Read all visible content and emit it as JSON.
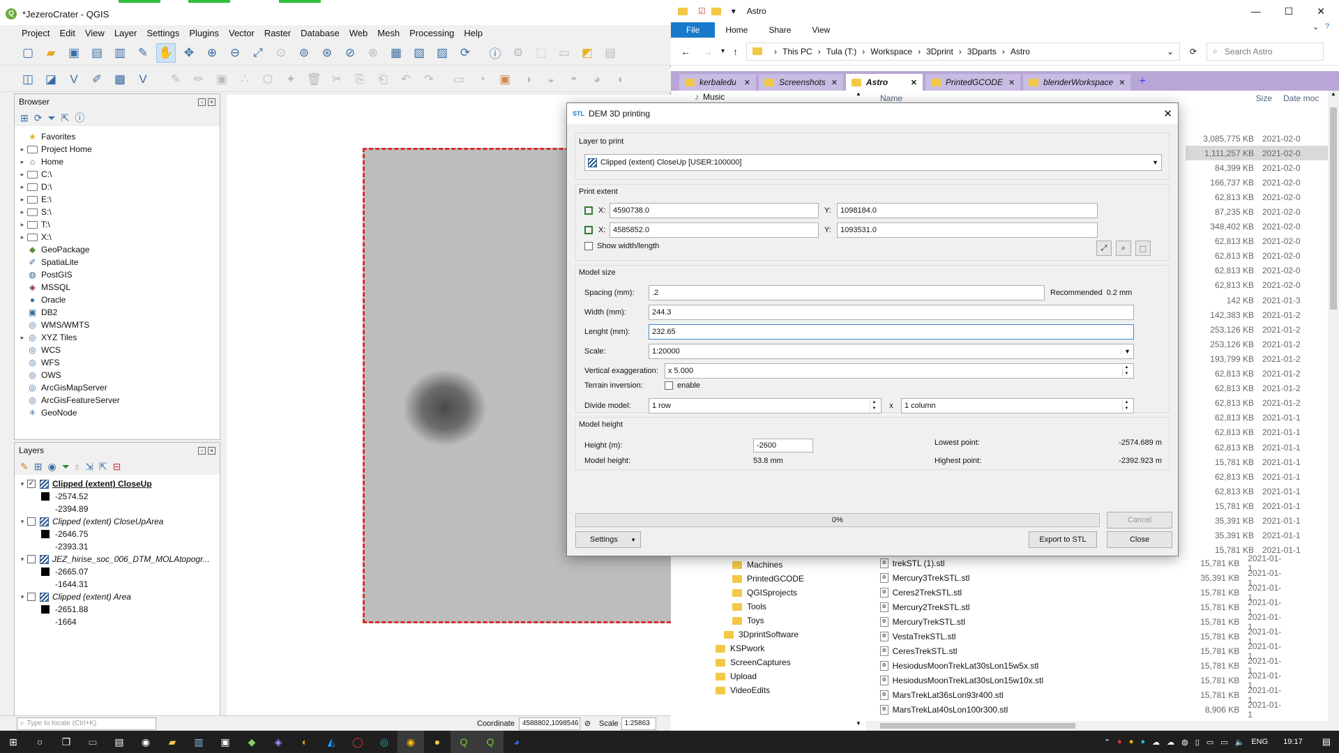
{
  "qgis": {
    "title": "*JezeroCrater - QGIS",
    "menus": [
      "Project",
      "Edit",
      "View",
      "Layer",
      "Settings",
      "Plugins",
      "Vector",
      "Raster",
      "Database",
      "Web",
      "Mesh",
      "Processing",
      "Help"
    ],
    "browser": {
      "title": "Browser",
      "items": [
        {
          "label": "Favorites",
          "icon": "star-icon",
          "arrow": ""
        },
        {
          "label": "Project Home",
          "icon": "folder-icon",
          "arrow": "▸"
        },
        {
          "label": "Home",
          "icon": "home-icon",
          "arrow": "▸"
        },
        {
          "label": "C:\\",
          "icon": "folder-icon",
          "arrow": "▸"
        },
        {
          "label": "D:\\",
          "icon": "folder-icon",
          "arrow": "▸"
        },
        {
          "label": "E:\\",
          "icon": "folder-icon",
          "arrow": "▸"
        },
        {
          "label": "S:\\",
          "icon": "folder-icon",
          "arrow": "▸"
        },
        {
          "label": "T:\\",
          "icon": "folder-icon",
          "arrow": "▸"
        },
        {
          "label": "X:\\",
          "icon": "folder-icon",
          "arrow": "▸"
        },
        {
          "label": "GeoPackage",
          "icon": "geopackage-icon",
          "arrow": ""
        },
        {
          "label": "SpatiaLite",
          "icon": "spatialite-icon",
          "arrow": ""
        },
        {
          "label": "PostGIS",
          "icon": "postgis-icon",
          "arrow": ""
        },
        {
          "label": "MSSQL",
          "icon": "mssql-icon",
          "arrow": ""
        },
        {
          "label": "Oracle",
          "icon": "oracle-icon",
          "arrow": ""
        },
        {
          "label": "DB2",
          "icon": "db2-icon",
          "arrow": ""
        },
        {
          "label": "WMS/WMTS",
          "icon": "globe-icon",
          "arrow": ""
        },
        {
          "label": "XYZ Tiles",
          "icon": "globe-icon",
          "arrow": "▸"
        },
        {
          "label": "WCS",
          "icon": "globe-icon",
          "arrow": ""
        },
        {
          "label": "WFS",
          "icon": "globe-icon",
          "arrow": ""
        },
        {
          "label": "OWS",
          "icon": "globe-icon",
          "arrow": ""
        },
        {
          "label": "ArcGisMapServer",
          "icon": "globe-icon",
          "arrow": ""
        },
        {
          "label": "ArcGisFeatureServer",
          "icon": "globe-icon",
          "arrow": ""
        },
        {
          "label": "GeoNode",
          "icon": "geonode-icon",
          "arrow": ""
        }
      ]
    },
    "layers": {
      "title": "Layers",
      "items": [
        {
          "name": "Clipped (extent) CloseUp",
          "checked": true,
          "active": true,
          "min": "-2574.52",
          "max": "-2394.89"
        },
        {
          "name": "Clipped (extent) CloseUpArea",
          "checked": false,
          "active": false,
          "min": "-2646.75",
          "max": "-2393.31"
        },
        {
          "name": "JEZ_hirise_soc_006_DTM_MOLAtopogr...",
          "checked": false,
          "active": false,
          "min": "-2665.07",
          "max": "-1644.31"
        },
        {
          "name": "Clipped (extent) Area",
          "checked": false,
          "active": false,
          "min": "-2651.88",
          "max": "-1664"
        }
      ]
    },
    "status": {
      "locate_placeholder": "Type to locate (Ctrl+K)",
      "coord_label": "Coordinate",
      "coord_value": "4588802,1098546",
      "scale_label": "Scale",
      "scale_value": "1:25863"
    }
  },
  "explorer": {
    "title": "Astro",
    "ribbon": [
      "File",
      "Home",
      "Share",
      "View"
    ],
    "breadcrumb": [
      "This PC",
      "Tula (T:)",
      "Workspace",
      "3Dprint",
      "3Dparts",
      "Astro"
    ],
    "search_placeholder": "Search Astro",
    "tabs": [
      {
        "label": "kerbaledu",
        "active": false
      },
      {
        "label": "Screenshots",
        "active": false
      },
      {
        "label": "Astro",
        "active": true
      },
      {
        "label": "PrintedGCODE",
        "active": false
      },
      {
        "label": "blenderWorkspace",
        "active": false
      }
    ],
    "col_name": "Name",
    "col_size": "Size",
    "col_date": "Date moc",
    "nav_top": "Music",
    "nav_items": [
      {
        "label": "Machines",
        "indent": 1
      },
      {
        "label": "PrintedGCODE",
        "indent": 1
      },
      {
        "label": "QGISprojects",
        "indent": 1
      },
      {
        "label": "Tools",
        "indent": 1
      },
      {
        "label": "Toys",
        "indent": 1
      },
      {
        "label": "3DprintSoftware",
        "indent": 0.5
      },
      {
        "label": "KSPwork",
        "indent": 0
      },
      {
        "label": "ScreenCaptures",
        "indent": 0
      },
      {
        "label": "Upload",
        "indent": 0
      },
      {
        "label": "VideoEdits",
        "indent": 0
      }
    ],
    "sizes_top": [
      {
        "size": "3,085,775 KB",
        "date": "2021-02-0"
      },
      {
        "size": "1,111,257 KB",
        "date": "2021-02-0"
      },
      {
        "size": "84,399 KB",
        "date": "2021-02-0"
      },
      {
        "size": "166,737 KB",
        "date": "2021-02-0"
      },
      {
        "size": "62,813 KB",
        "date": "2021-02-0"
      },
      {
        "size": "87,235 KB",
        "date": "2021-02-0"
      },
      {
        "size": "348,402 KB",
        "date": "2021-02-0"
      },
      {
        "size": "62,813 KB",
        "date": "2021-02-0"
      },
      {
        "size": "62,813 KB",
        "date": "2021-02-0"
      },
      {
        "size": "62,813 KB",
        "date": "2021-02-0"
      },
      {
        "size": "62,813 KB",
        "date": "2021-02-0"
      },
      {
        "size": "142 KB",
        "date": "2021-01-3"
      },
      {
        "size": "142,383 KB",
        "date": "2021-01-2"
      },
      {
        "size": "253,126 KB",
        "date": "2021-01-2"
      },
      {
        "size": "253,126 KB",
        "date": "2021-01-2"
      },
      {
        "size": "193,799 KB",
        "date": "2021-01-2"
      },
      {
        "size": "62,813 KB",
        "date": "2021-01-2"
      },
      {
        "size": "62,813 KB",
        "date": "2021-01-2"
      },
      {
        "size": "62,813 KB",
        "date": "2021-01-2"
      },
      {
        "size": "62,813 KB",
        "date": "2021-01-1"
      },
      {
        "size": "62,813 KB",
        "date": "2021-01-1"
      },
      {
        "size": "62,813 KB",
        "date": "2021-01-1"
      },
      {
        "size": "15,781 KB",
        "date": "2021-01-1"
      },
      {
        "size": "62,813 KB",
        "date": "2021-01-1"
      },
      {
        "size": "62,813 KB",
        "date": "2021-01-1"
      },
      {
        "size": "15,781 KB",
        "date": "2021-01-1"
      },
      {
        "size": "35,391 KB",
        "date": "2021-01-1"
      },
      {
        "size": "35,391 KB",
        "date": "2021-01-1"
      },
      {
        "size": "15,781 KB",
        "date": "2021-01-1"
      }
    ],
    "files": [
      {
        "name": "trekSTL (1).stl",
        "size": "15,781 KB",
        "date": "2021-01-1"
      },
      {
        "name": "Mercury3TrekSTL.stl",
        "size": "35,391 KB",
        "date": "2021-01-1"
      },
      {
        "name": "Ceres2TrekSTL.stl",
        "size": "15,781 KB",
        "date": "2021-01-1"
      },
      {
        "name": "Mercury2TrekSTL.stl",
        "size": "15,781 KB",
        "date": "2021-01-1"
      },
      {
        "name": "MercuryTrekSTL.stl",
        "size": "15,781 KB",
        "date": "2021-01-1"
      },
      {
        "name": "VestaTrekSTL.stl",
        "size": "15,781 KB",
        "date": "2021-01-1"
      },
      {
        "name": "CeresTrekSTL.stl",
        "size": "15,781 KB",
        "date": "2021-01-1"
      },
      {
        "name": "HesiodusMoonTrekLat30sLon15w5x.stl",
        "size": "15,781 KB",
        "date": "2021-01-1"
      },
      {
        "name": "HesiodusMoonTrekLat30sLon15w10x.stl",
        "size": "15,781 KB",
        "date": "2021-01-1"
      },
      {
        "name": "MarsTrekLat36sLon93r400.stl",
        "size": "15,781 KB",
        "date": "2021-01-1"
      },
      {
        "name": "MarsTrekLat40sLon100r300.stl",
        "size": "8,906 KB",
        "date": "2021-01-1"
      }
    ]
  },
  "dialog": {
    "title": "DEM 3D printing",
    "title_prefix": "STL",
    "layer_group": "Layer to print",
    "layer_value": "Clipped (extent) CloseUp [USER:100000]",
    "extent_group": "Print extent",
    "x1": "4590738.0",
    "y1": "1098184.0",
    "x2": "4585852.0",
    "y2": "1093531.0",
    "x_label": "X:",
    "y_label": "Y:",
    "show_wl": "Show width/length",
    "model_group": "Model size",
    "spacing_label": "Spacing (mm):",
    "spacing_value": ".2",
    "recommended_label": "Recommended",
    "recommended_value": "0.2 mm",
    "width_label": "Width (mm):",
    "width_value": "244.3",
    "length_label": "Lenght (mm):",
    "length_value": "232.65",
    "scale_label": "Scale:",
    "scale_value": "1:20000",
    "vexag_label": "Vertical exaggeration:",
    "vexag_value": "x 5.000",
    "inversion_label": "Terrain inversion:",
    "inversion_opt": "enable",
    "divide_label": "Divide model:",
    "divide_rows": "1 row",
    "divide_x": "x",
    "divide_cols": "1 column",
    "height_group": "Model height",
    "height_label": "Height (m):",
    "height_value": "-2600",
    "model_height_label": "Model height:",
    "model_height_value": "53.8 mm",
    "lowest_label": "Lowest point:",
    "lowest_value": "-2574.689 m",
    "highest_label": "Highest point:",
    "highest_value": "-2392.923 m",
    "progress_text": "0%",
    "progress": 0,
    "cancel": "Cancel",
    "settings": "Settings",
    "export": "Export to STL",
    "close": "Close"
  },
  "taskbar": {
    "lang": "ENG",
    "time": "19:17"
  }
}
